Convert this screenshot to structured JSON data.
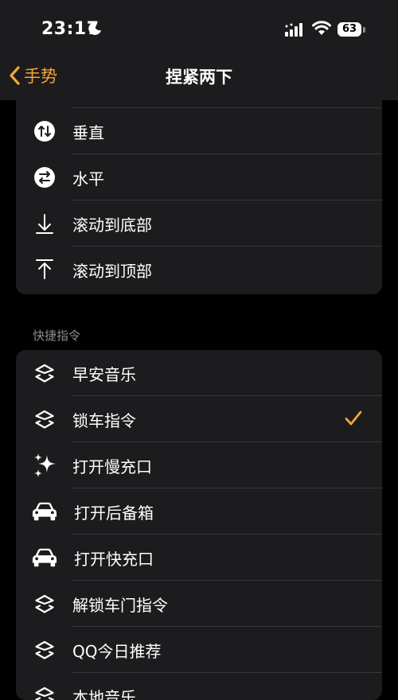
{
  "status_bar": {
    "time": "23:17",
    "battery": "63"
  },
  "nav": {
    "back_label": "手势",
    "title": "捏紧两下"
  },
  "scroll_options": [
    {
      "label": "垂直",
      "icon": "vertical-arrows-icon"
    },
    {
      "label": "水平",
      "icon": "horizontal-arrows-icon"
    },
    {
      "label": "滚动到底部",
      "icon": "arrow-down-to-line-icon"
    },
    {
      "label": "滚动到顶部",
      "icon": "arrow-up-to-line-icon"
    }
  ],
  "shortcuts_section": {
    "header": "快捷指令",
    "items": [
      {
        "label": "早安音乐",
        "icon": "shortcuts-icon",
        "selected": false
      },
      {
        "label": "锁车指令",
        "icon": "shortcuts-icon",
        "selected": true
      },
      {
        "label": "打开慢充口",
        "icon": "sparkles-icon",
        "selected": false
      },
      {
        "label": "打开后备箱",
        "icon": "car-icon",
        "selected": false
      },
      {
        "label": "打开快充口",
        "icon": "car-icon",
        "selected": false
      },
      {
        "label": "解锁车门指令",
        "icon": "shortcuts-icon",
        "selected": false
      },
      {
        "label": "QQ今日推荐",
        "icon": "shortcuts-icon",
        "selected": false
      },
      {
        "label": "本地音乐",
        "icon": "shortcuts-icon",
        "selected": false
      }
    ]
  },
  "colors": {
    "accent": "#f7a43a",
    "background": "#000000",
    "cell": "#1c1c1e",
    "separator": "#38383a",
    "secondary_text": "#8d8d93"
  }
}
